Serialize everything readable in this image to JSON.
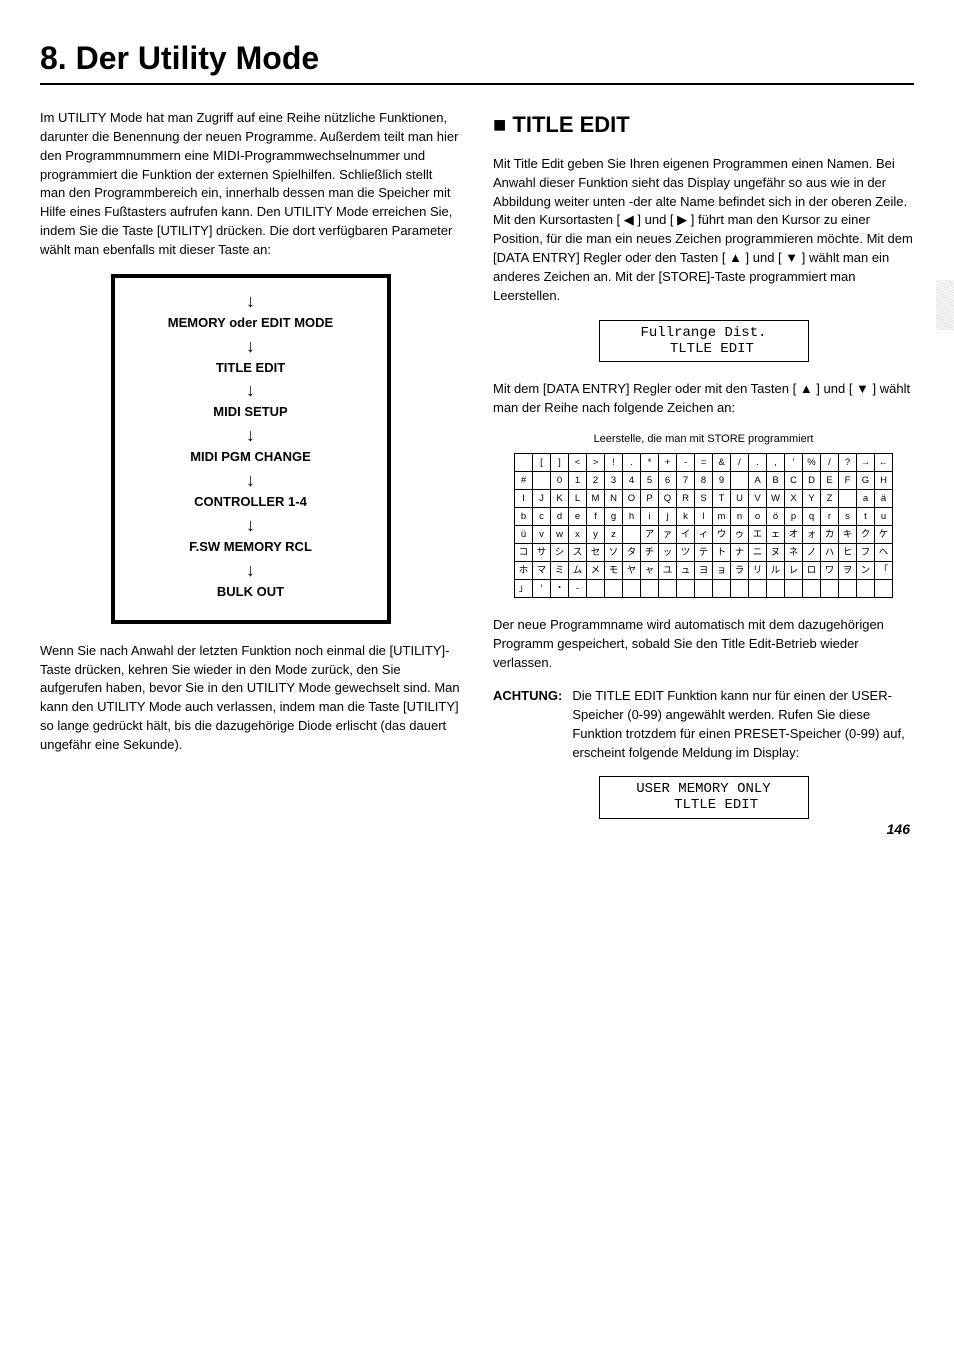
{
  "title": "8. Der Utility Mode",
  "left": {
    "intro": "Im UTILITY Mode hat man Zugriff auf eine Reihe nützliche Funktionen, darunter die Benennung der neuen Programme. Außerdem teilt man hier den Programmnummern eine MIDI-Programmwechselnummer und programmiert die Funktion der externen Spielhilfen. Schließlich stellt man den Programmbereich ein, innerhalb dessen man die Speicher mit Hilfe eines Fußtasters aufrufen kann. Den UTILITY Mode erreichen Sie, indem Sie die Taste [UTILITY] drücken. Die dort verfügbaren Parameter wählt man ebenfalls mit dieser Taste an:",
    "flow": [
      "MEMORY oder EDIT MODE",
      "TITLE EDIT",
      "MIDI SETUP",
      "MIDI PGM CHANGE",
      "CONTROLLER 1-4",
      "F.SW MEMORY RCL",
      "BULK OUT"
    ],
    "after_flow": "Wenn Sie nach Anwahl der letzten Funktion noch einmal die [UTILITY]-Taste drücken, kehren Sie wieder in den Mode zurück, den Sie aufgerufen haben, bevor Sie in den UTILITY Mode gewechselt sind. Man kann den UTILITY Mode auch verlassen, indem man die Taste [UTILITY] so lange gedrückt hält, bis die dazugehörige Diode erlischt (das dauert ungefähr eine Sekunde)."
  },
  "right": {
    "heading": "TITLE EDIT",
    "p1": "Mit Title Edit geben Sie Ihren eigenen Programmen einen Namen. Bei Anwahl dieser Funktion sieht das Display ungefähr so aus wie in der Abbildung weiter unten -der alte Name befindet sich in der oberen Zeile. Mit den Kursortasten [ ◀ ] und [ ▶ ] führt man den Kursor zu einer Position, für die man ein neues Zeichen programmieren möchte. Mit dem [DATA ENTRY] Regler oder den Tasten [ ▲ ] und [ ▼ ] wählt man ein anderes Zeichen an. Mit der [STORE]-Taste programmiert man Leerstellen.",
    "lcd1": "Fullrange Dist.\n  TLTLE EDIT",
    "p2": "Mit dem [DATA ENTRY] Regler oder mit den Tasten [ ▲ ] und [ ▼ ] wählt man der Reihe nach folgende Zeichen an:",
    "caption": "Leerstelle, die man mit STORE programmiert",
    "char_rows": [
      [
        " ",
        "[",
        "]",
        "<",
        ">",
        "!",
        ".",
        "*",
        "+",
        "-",
        "=",
        "&",
        "/",
        ".",
        ",",
        "'",
        "%",
        "/",
        "?",
        "→",
        "←"
      ],
      [
        "#",
        " ",
        "0",
        "1",
        "2",
        "3",
        "4",
        "5",
        "6",
        "7",
        "8",
        "9",
        " ",
        "A",
        "B",
        "C",
        "D",
        "E",
        "F",
        "G",
        "H"
      ],
      [
        "I",
        "J",
        "K",
        "L",
        "M",
        "N",
        "O",
        "P",
        "Q",
        "R",
        "S",
        "T",
        "U",
        "V",
        "W",
        "X",
        "Y",
        "Z",
        " ",
        "a",
        "ä"
      ],
      [
        "b",
        "c",
        "d",
        "e",
        "f",
        "g",
        "h",
        "i",
        "j",
        "k",
        "l",
        "m",
        "n",
        "o",
        "ö",
        "p",
        "q",
        "r",
        "s",
        "t",
        "u"
      ],
      [
        "ü",
        "v",
        "w",
        "x",
        "y",
        "z",
        " ",
        "ア",
        "ァ",
        "イ",
        "ィ",
        "ウ",
        "ゥ",
        "エ",
        "ェ",
        "オ",
        "ォ",
        "カ",
        "キ",
        "ク",
        "ケ"
      ],
      [
        "コ",
        "サ",
        "シ",
        "ス",
        "セ",
        "ソ",
        "タ",
        "チ",
        "ッ",
        "ツ",
        "テ",
        "ト",
        "ナ",
        "ニ",
        "ヌ",
        "ネ",
        "ノ",
        "ハ",
        "ヒ",
        "フ",
        "ヘ"
      ],
      [
        "ホ",
        "マ",
        "ミ",
        "ム",
        "メ",
        "モ",
        "ヤ",
        "ャ",
        "ユ",
        "ュ",
        "ヨ",
        "ョ",
        "ラ",
        "リ",
        "ル",
        "レ",
        "ロ",
        "ワ",
        "ヲ",
        "ン",
        "「"
      ],
      [
        "」",
        "'",
        "・",
        "-",
        " ",
        " ",
        " ",
        " ",
        " ",
        " ",
        " ",
        " ",
        " ",
        " ",
        " ",
        " ",
        " ",
        " ",
        " ",
        " ",
        " "
      ]
    ],
    "p3": "Der neue Programmname wird automatisch mit dem dazugehörigen Programm gespeichert, sobald Sie den Title Edit-Betrieb wieder verlassen.",
    "attention_label": "ACHTUNG:",
    "attention": "Die TITLE EDIT Funktion kann nur für einen der USER-Speicher (0-99) angewählt werden. Rufen Sie diese Funktion trotzdem für einen PRESET-Speicher (0-99) auf, erscheint folgende Meldung im Display:",
    "lcd2": "USER MEMORY ONLY\n   TLTLE EDIT"
  },
  "page_number": "146"
}
